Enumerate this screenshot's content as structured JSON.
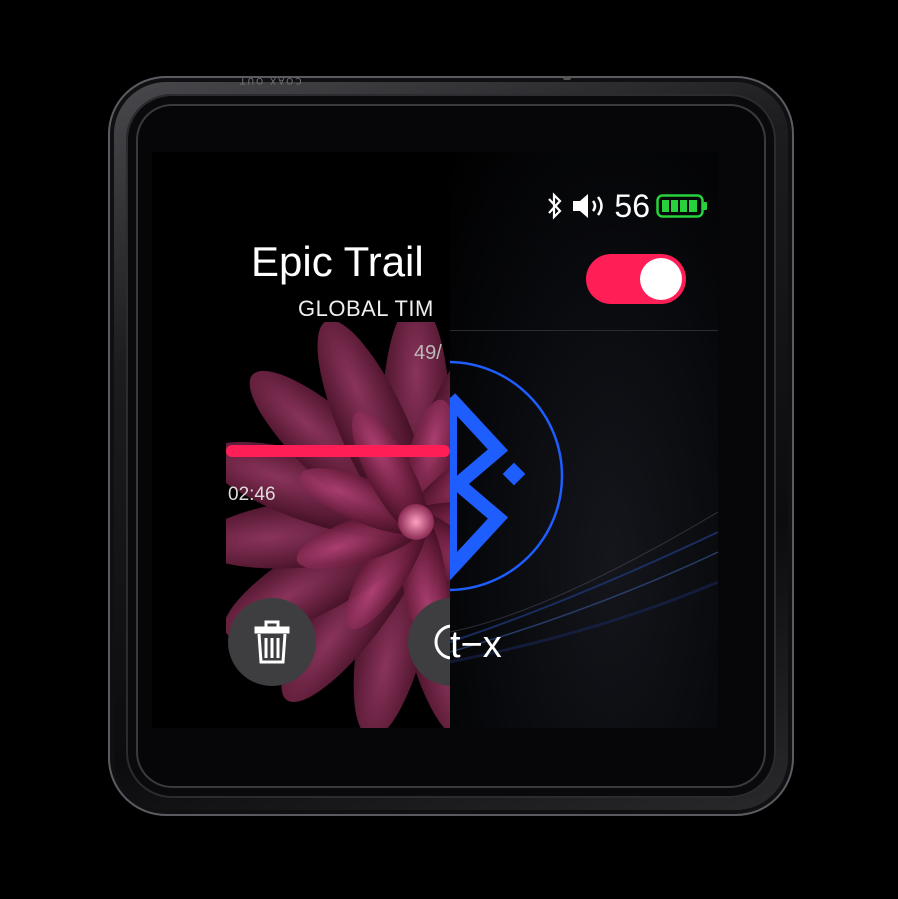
{
  "device": {
    "port_label": "COAX OUT"
  },
  "player": {
    "title": "Epic Trail",
    "artist": "GLOBAL TIM",
    "track_position": "49/",
    "elapsed": "02:46",
    "progress_fraction": 0.32,
    "accent_color": "#ff1e56",
    "buttons": [
      {
        "icon": "trash-icon"
      },
      {
        "icon": "timer-icon"
      }
    ]
  },
  "bluetooth_panel": {
    "status": {
      "bluetooth_icon": "bluetooth-icon",
      "volume_icon": "speaker-icon",
      "volume": "56",
      "battery_icon": "battery-icon",
      "battery_color": "#28d23c"
    },
    "toggle_on": true,
    "toggle_color": "#ff1e56",
    "big_icon": "bluetooth-icon",
    "icon_color": "#1e5eff",
    "mode_label": "t−x"
  }
}
